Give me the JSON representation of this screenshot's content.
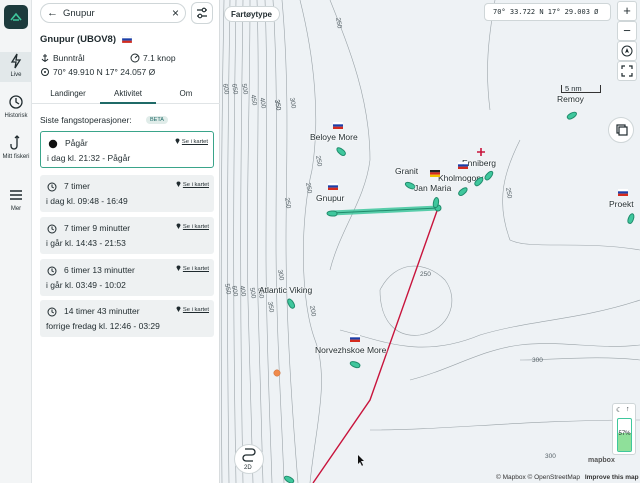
{
  "rail": {
    "items": [
      {
        "label": "Live",
        "icon": "bolt-icon"
      },
      {
        "label": "Historisk",
        "icon": "history-icon"
      },
      {
        "label": "Mitt fiskeri",
        "icon": "hook-icon"
      },
      {
        "label": "Mer",
        "icon": "menu-icon"
      }
    ]
  },
  "search": {
    "value": "Gnupur"
  },
  "vessel": {
    "name": "Gnupur (UBOV8)",
    "gear": "Bunntrål",
    "speed": "7.1 knop",
    "position": "70° 49.910 N 17° 24.057 Ø"
  },
  "tabs": [
    "Landinger",
    "Aktivitet",
    "Om"
  ],
  "section_title": "Siste fangstoperasjoner:",
  "beta": "BETA",
  "operations": [
    {
      "duration": "Pågår",
      "time": "i dag kl. 21:32  -  Pågår",
      "link": "Se i kartet"
    },
    {
      "duration": "7 timer",
      "time": "i dag kl. 09:48  -  16:49",
      "link": "Se i kartet"
    },
    {
      "duration": "7 timer 9 minutter",
      "time": "i går kl. 14:43  -  21:53",
      "link": "Se i kartet"
    },
    {
      "duration": "6 timer 13 minutter",
      "time": "i går kl. 03:49  -  10:02",
      "link": "Se i kartet"
    },
    {
      "duration": "14 timer 43 minutter",
      "time": "forrige fredag kl. 12:46  -  03:29",
      "link": "Se i kartet"
    }
  ],
  "map": {
    "filter_label": "Fartøytype",
    "coords": "70° 33.722 N 17° 29.003 Ø",
    "scale": "5 nm",
    "mode": "2D",
    "battery": "57%",
    "attribution": "© Mapbox © OpenStreetMap",
    "improve": "Improve this map",
    "logo": "mapbox",
    "vessels": [
      "Beloye More",
      "Granit",
      "Enniberg",
      "Kholmogory",
      "Jan Maria",
      "Gnupur",
      "Remoy",
      "Proekt",
      "Atlantic Viking",
      "Norvezhskoe More"
    ],
    "depths": [
      "250",
      "250",
      "250",
      "250",
      "300",
      "600",
      "650",
      "500",
      "450",
      "400",
      "350",
      "300",
      "250",
      "200",
      "550",
      "350",
      "350",
      "300",
      "400",
      "500",
      "600",
      "650",
      "300",
      "250"
    ]
  },
  "colors": {
    "accent": "#1f6a67",
    "vessel": "#3fc79d",
    "track": "#c8143c"
  }
}
